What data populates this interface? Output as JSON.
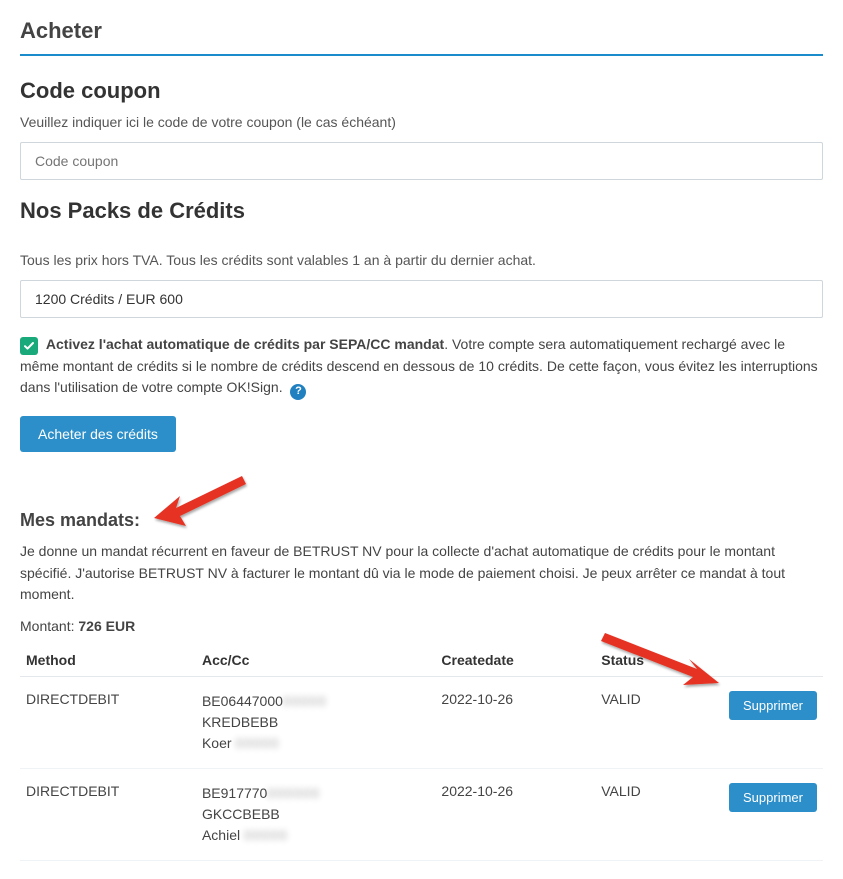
{
  "pageTitle": "Acheter",
  "coupon": {
    "heading": "Code coupon",
    "description": "Veuillez indiquer ici le code de votre coupon (le cas échéant)",
    "placeholder": "Code coupon"
  },
  "packs": {
    "heading": "Nos Packs de Crédits",
    "note": "Tous les prix hors TVA. Tous les crédits sont valables 1 an à partir du dernier achat.",
    "selected": "1200 Crédits /  EUR 600",
    "autoPurchaseBold": "Activez l'achat automatique de crédits par SEPA/CC mandat",
    "autoPurchaseRest": ". Votre compte sera automatiquement rechargé avec le même montant de crédits si le nombre de crédits descend en dessous de 10 crédits. De cette façon, vous évitez les interruptions dans l'utilisation de votre compte OK!Sign.",
    "buyButton": "Acheter des crédits"
  },
  "mandates": {
    "heading": "Mes mandats:",
    "description": "Je donne un mandat récurrent en faveur de BETRUST NV pour la collecte d'achat automatique de crédits pour le montant spécifié. J'autorise BETRUST NV à facturer le montant dû via le mode de paiement choisi. Je peux arrêter ce mandat à tout moment.",
    "amountLabel": "Montant: ",
    "amountValue": "726 EUR",
    "columns": {
      "method": "Method",
      "acc": "Acc/Cc",
      "createdate": "Createdate",
      "status": "Status"
    },
    "deleteLabel": "Supprimer",
    "rows": [
      {
        "method": "DIRECTDEBIT",
        "acc1": "BE06447000",
        "acc2": "KREDBEBB",
        "acc3": "Koer",
        "createdate": "2022-10-26",
        "status": "VALID"
      },
      {
        "method": "DIRECTDEBIT",
        "acc1": "BE917770",
        "acc2": "GKCCBEBB",
        "acc3": "Achiel",
        "createdate": "2022-10-26",
        "status": "VALID"
      }
    ]
  }
}
